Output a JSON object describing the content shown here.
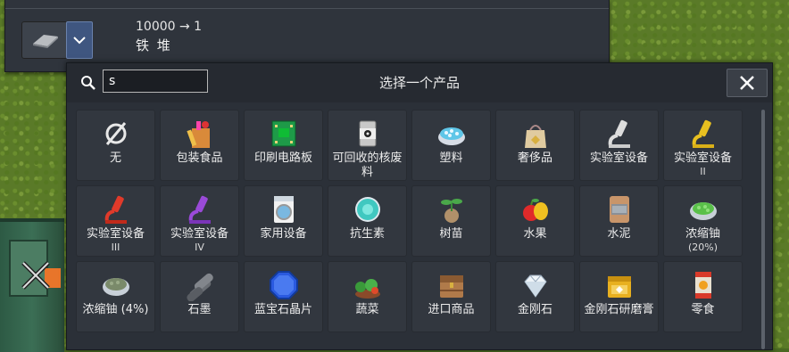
{
  "top_panel": {
    "ratio": "10000 → 1",
    "product_name": "铁 堆"
  },
  "dialog": {
    "title": "选择一个产品",
    "search_value": "s",
    "items": [
      {
        "label": "无",
        "sub": "",
        "icon": "none-icon"
      },
      {
        "label": "包装食品",
        "sub": "",
        "icon": "packaged-food-icon"
      },
      {
        "label": "印刷电路板",
        "sub": "",
        "icon": "circuit-board-icon"
      },
      {
        "label": "可回收的核废料",
        "sub": "",
        "icon": "nuclear-waste-icon"
      },
      {
        "label": "塑料",
        "sub": "",
        "icon": "plastic-icon"
      },
      {
        "label": "奢侈品",
        "sub": "",
        "icon": "luxury-goods-icon"
      },
      {
        "label": "实验室设备",
        "sub": "",
        "icon": "lab-equipment-icon"
      },
      {
        "label": "实验室设备",
        "sub": "II",
        "icon": "lab-equipment-2-icon"
      },
      {
        "label": "实验室设备",
        "sub": "III",
        "icon": "lab-equipment-3-icon"
      },
      {
        "label": "实验室设备",
        "sub": "IV",
        "icon": "lab-equipment-4-icon"
      },
      {
        "label": "家用设备",
        "sub": "",
        "icon": "washing-machine-icon"
      },
      {
        "label": "抗生素",
        "sub": "",
        "icon": "antibiotics-icon"
      },
      {
        "label": "树苗",
        "sub": "",
        "icon": "sapling-icon"
      },
      {
        "label": "水果",
        "sub": "",
        "icon": "fruit-icon"
      },
      {
        "label": "水泥",
        "sub": "",
        "icon": "cement-bag-icon"
      },
      {
        "label": "浓缩铀",
        "sub": "(20%)",
        "icon": "enriched-uranium-20-icon"
      },
      {
        "label": "浓缩铀 (4%)",
        "sub": "",
        "icon": "enriched-uranium-4-icon"
      },
      {
        "label": "石墨",
        "sub": "",
        "icon": "graphite-icon"
      },
      {
        "label": "蓝宝石晶片",
        "sub": "",
        "icon": "sapphire-wafer-icon"
      },
      {
        "label": "蔬菜",
        "sub": "",
        "icon": "vegetables-icon"
      },
      {
        "label": "进口商品",
        "sub": "",
        "icon": "import-chest-icon"
      },
      {
        "label": "金刚石",
        "sub": "",
        "icon": "diamond-icon"
      },
      {
        "label": "金刚石研磨膏",
        "sub": "",
        "icon": "diamond-paste-icon"
      },
      {
        "label": "零食",
        "sub": "",
        "icon": "snacks-icon"
      }
    ]
  },
  "colors": {
    "panel_bg": "#2b3038",
    "tile_bg": "#32373f",
    "dropdown_blue": "#3f5680"
  }
}
